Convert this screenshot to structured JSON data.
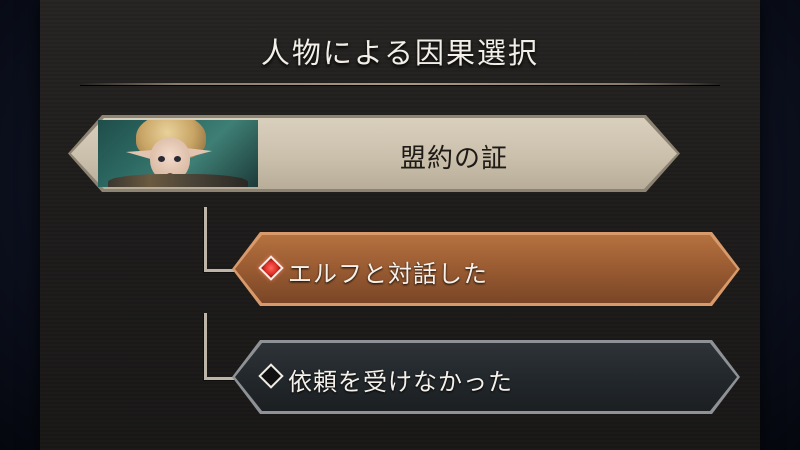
{
  "screen": {
    "title": "人物による因果選択"
  },
  "banner": {
    "label": "盟約の証",
    "portrait_icon": "elf-portrait"
  },
  "options": [
    {
      "label": "エルフと対話した",
      "icon": "red-diamond-icon",
      "selected": true
    },
    {
      "label": "依頼を受けなかった",
      "icon": "black-diamond-icon",
      "selected": false
    }
  ],
  "colors": {
    "selected_option": "#9c5d33",
    "unselected_option": "#23282c",
    "banner": "#cbc0ac"
  }
}
